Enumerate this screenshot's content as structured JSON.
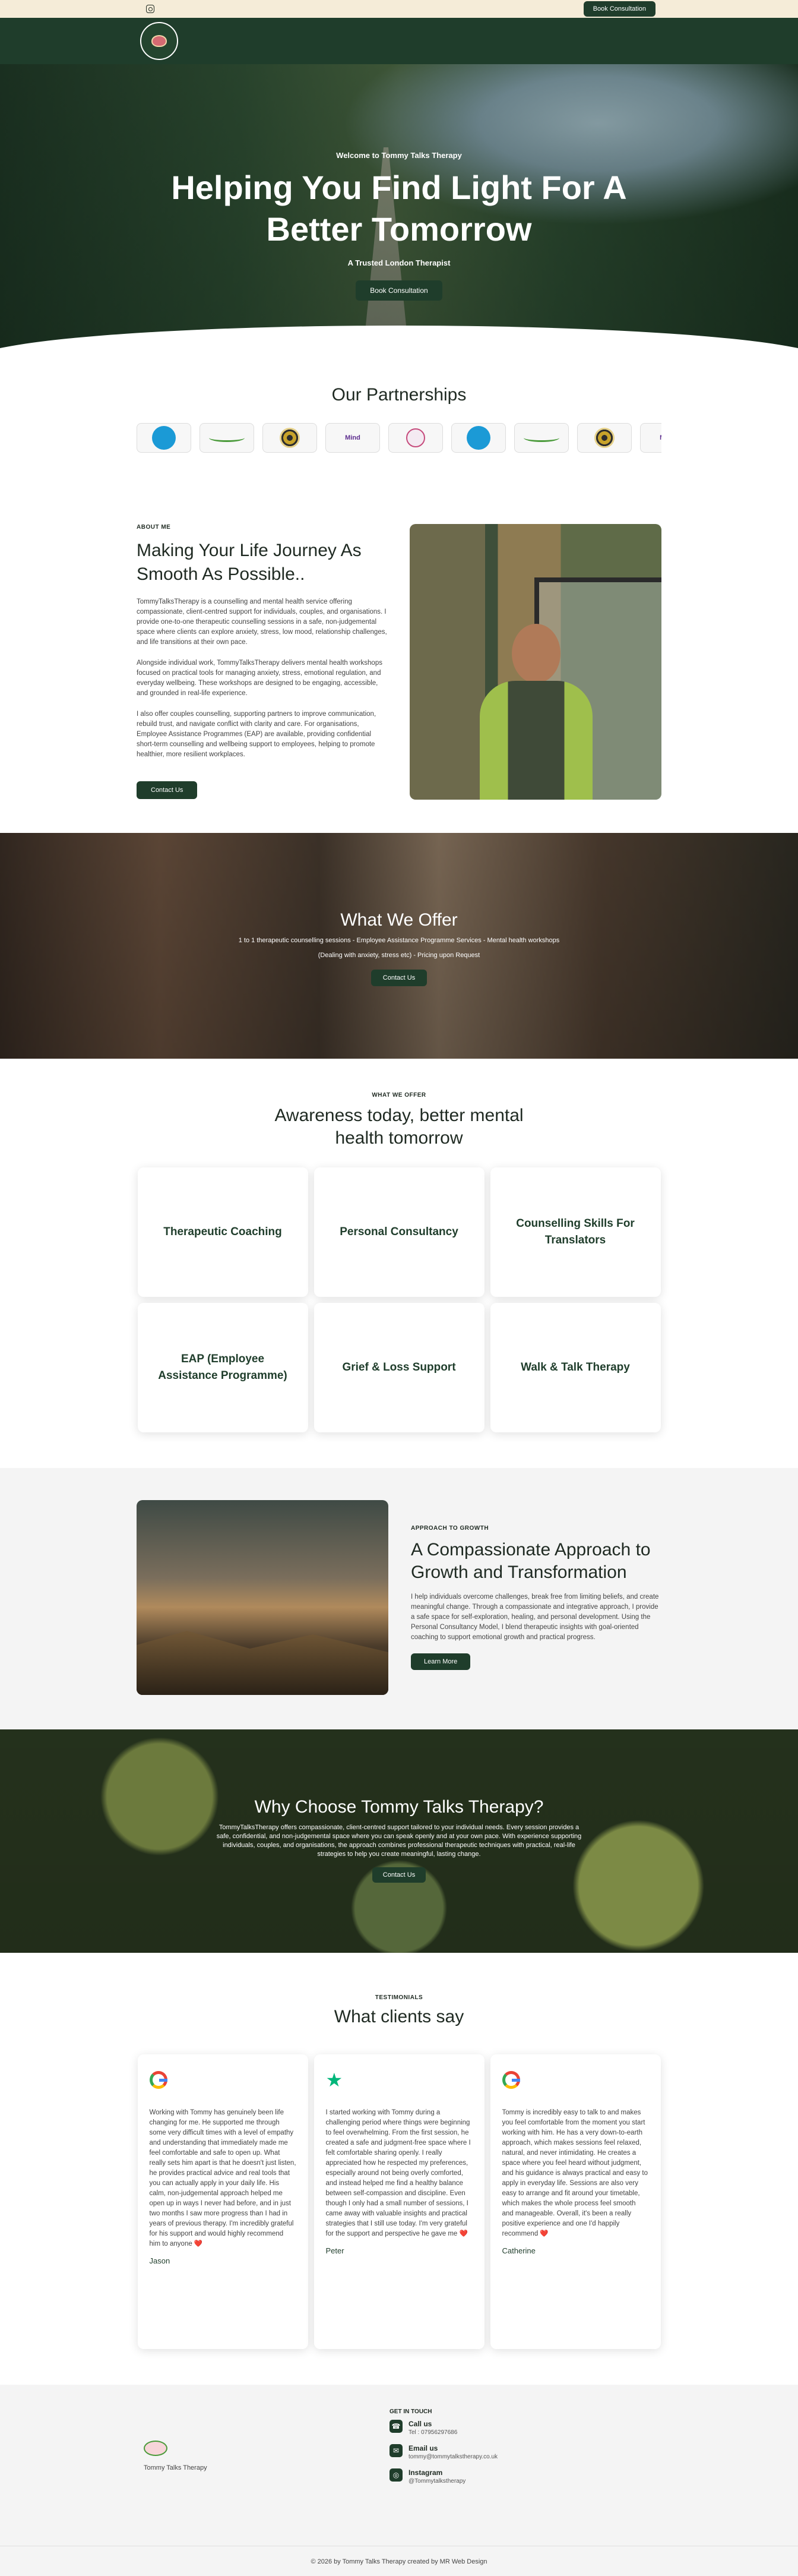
{
  "topbar": {
    "book_label": "Book Consultation"
  },
  "hero": {
    "pre": "Welcome to Tommy Talks Therapy",
    "title": "Helping You Find Light For A Better Tomorrow",
    "sub": "A Trusted London Therapist",
    "cta": "Book Consultation"
  },
  "partners": {
    "title": "Our Partnerships",
    "logos": [
      "Mind",
      "Mind"
    ]
  },
  "about": {
    "eyebrow": "ABOUT ME",
    "title": "Making Your Life Journey As Smooth As Possible..",
    "p1": "TommyTalksTherapy is a counselling and mental health service offering compassionate, client-centred support for individuals, couples, and organisations. I provide one-to-one therapeutic counselling sessions in a safe, non-judgemental space where clients can explore anxiety, stress, low mood, relationship challenges, and life transitions at their own pace.",
    "p2": "Alongside individual work, TommyTalksTherapy delivers mental health workshops focused on practical tools for managing anxiety, stress, emotional regulation, and everyday wellbeing. These workshops are designed to be engaging, accessible, and grounded in real-life experience.",
    "p3": "I also offer couples counselling, supporting partners to improve communication, rebuild trust, and navigate conflict with clarity and care. For organisations, Employee Assistance Programmes (EAP) are available, providing confidential short-term counselling and wellbeing support to employees, helping to promote healthier, more resilient workplaces.",
    "cta": "Contact Us"
  },
  "offer": {
    "title": "What We Offer",
    "line1": "1 to 1 therapeutic counselling sessions - Employee Assistance Programme Services - Mental health workshops",
    "line2": "(Dealing with anxiety, stress etc) - Pricing upon Request",
    "cta": "Contact Us"
  },
  "services": {
    "eyebrow": "WHAT WE OFFER",
    "title": "Awareness today, better mental health tomorrow",
    "items": [
      "Therapeutic Coaching",
      "Personal Consultancy",
      "Counselling Skills For Translators",
      "EAP (Employee Assistance Programme)",
      "Grief & Loss Support",
      "Walk & Talk Therapy"
    ]
  },
  "approach": {
    "eyebrow": "APPROACH TO GROWTH",
    "title": "A Compassionate Approach to Growth and Transformation",
    "body": "I help individuals overcome challenges, break free from limiting beliefs, and create meaningful change. Through a compassionate and integrative approach, I provide a safe space for self-exploration, healing, and personal development. Using the Personal Consultancy Model, I blend therapeutic insights with goal-oriented coaching to support emotional growth and practical progress.",
    "cta": "Learn More"
  },
  "why": {
    "title": "Why Choose Tommy Talks Therapy?",
    "body": "TommyTalksTherapy offers compassionate, client-centred support tailored to your individual needs. Every session provides a safe, confidential, and non-judgemental space where you can speak openly and at your own pace. With experience supporting individuals, couples, and organisations, the approach combines professional therapeutic techniques with practical, real-life strategies to help you create meaningful, lasting change.",
    "cta": "Contact Us"
  },
  "testimonials": {
    "eyebrow": "TESTIMONIALS",
    "title": "What clients say",
    "items": [
      {
        "icon": "google-icon",
        "text": "Working with Tommy has genuinely been life changing for me. He supported me through some very difficult times with a level of empathy and understanding that immediately made me feel comfortable and safe to open up. What really sets him apart is that he doesn't just listen, he provides practical advice and real tools that you can actually apply in your daily life. His calm, non-judgemental approach helped me open up in ways I never had before, and in just two months I saw more progress than I had in years of previous therapy. I'm incredibly grateful for his support and would highly recommend him to anyone ❤️",
        "name": "Jason"
      },
      {
        "icon": "trustpilot-star-icon",
        "text": "I started working with Tommy during a challenging period where things were beginning to feel overwhelming. From the first session, he created a safe and judgment-free space where I felt comfortable sharing openly. I really appreciated how he respected my preferences, especially around not being overly comforted, and instead helped me find a healthy balance between self-compassion and discipline. Even though I only had a small number of sessions, I came away with valuable insights and practical strategies that I still use today. I'm very grateful for the support and perspective he gave me ❤️",
        "name": "Peter"
      },
      {
        "icon": "google-icon",
        "text": "Tommy is incredibly easy to talk to and makes you feel comfortable from the moment you start working with him. He has a very down-to-earth approach, which makes sessions feel relaxed, natural, and never intimidating. He creates a space where you feel heard without judgment, and his guidance is always practical and easy to apply in everyday life. Sessions are also very easy to arrange and fit around your timetable, which makes the whole process feel smooth and manageable. Overall, it's been a really positive experience and one I'd happily recommend ❤️",
        "name": "Catherine"
      }
    ]
  },
  "footer": {
    "brand": "Tommy Talks Therapy",
    "contact_title": "GET IN TOUCH",
    "call_label": "Call us",
    "call_value": "Tel : 07956297686",
    "email_label": "Email us",
    "email_value": "tommy@tommytalkstherapy.co.uk",
    "instagram_label": "Instagram",
    "instagram_value": "@Tommytalkstherapy",
    "copyright": "© 2026 by Tommy Talks Therapy created by MR Web Design"
  }
}
